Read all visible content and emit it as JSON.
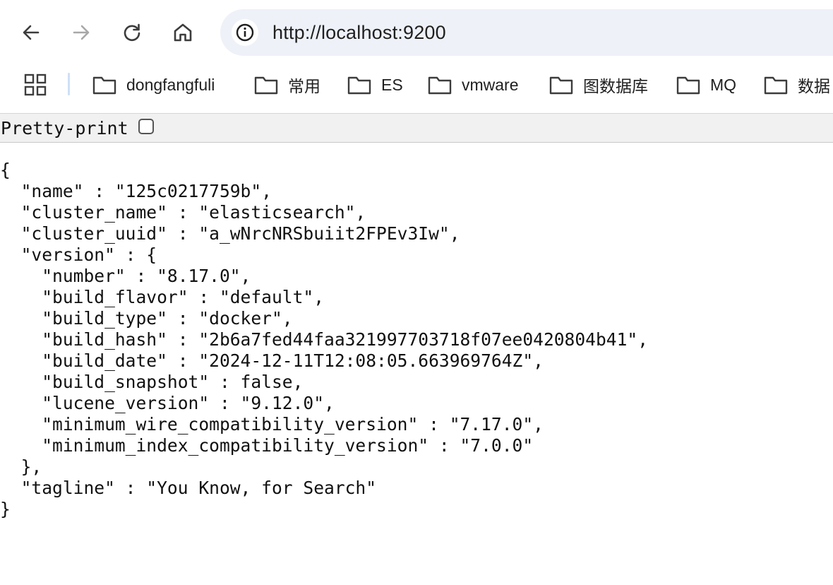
{
  "browser": {
    "nav": {
      "back": "back-arrow-icon",
      "forward": "forward-arrow-icon",
      "reload": "reload-icon",
      "home": "home-icon"
    },
    "address_bar": {
      "url": "http://localhost:9200",
      "site_info_icon": "info-icon"
    },
    "bookmarks": [
      {
        "label": "dongfangfuli",
        "icon": "folder-icon"
      },
      {
        "label": "常用",
        "icon": "folder-icon"
      },
      {
        "label": "ES",
        "icon": "folder-icon"
      },
      {
        "label": "vmware",
        "icon": "folder-icon"
      },
      {
        "label": "图数据库",
        "icon": "folder-icon"
      },
      {
        "label": "MQ",
        "icon": "folder-icon"
      },
      {
        "label": "数据",
        "icon": "folder-icon"
      }
    ],
    "apps_icon": "apps-grid-icon"
  },
  "viewer": {
    "pretty_print_label": "Pretty-print",
    "pretty_print_checked": false,
    "json_text": "{\n  \"name\" : \"125c0217759b\",\n  \"cluster_name\" : \"elasticsearch\",\n  \"cluster_uuid\" : \"a_wNrcNRSbuiit2FPEv3Iw\",\n  \"version\" : {\n    \"number\" : \"8.17.0\",\n    \"build_flavor\" : \"default\",\n    \"build_type\" : \"docker\",\n    \"build_hash\" : \"2b6a7fed44faa321997703718f07ee0420804b41\",\n    \"build_date\" : \"2024-12-11T12:08:05.663969764Z\",\n    \"build_snapshot\" : false,\n    \"lucene_version\" : \"9.12.0\",\n    \"minimum_wire_compatibility_version\" : \"7.17.0\",\n    \"minimum_index_compatibility_version\" : \"7.0.0\"\n  },\n  \"tagline\" : \"You Know, for Search\"\n}"
  }
}
